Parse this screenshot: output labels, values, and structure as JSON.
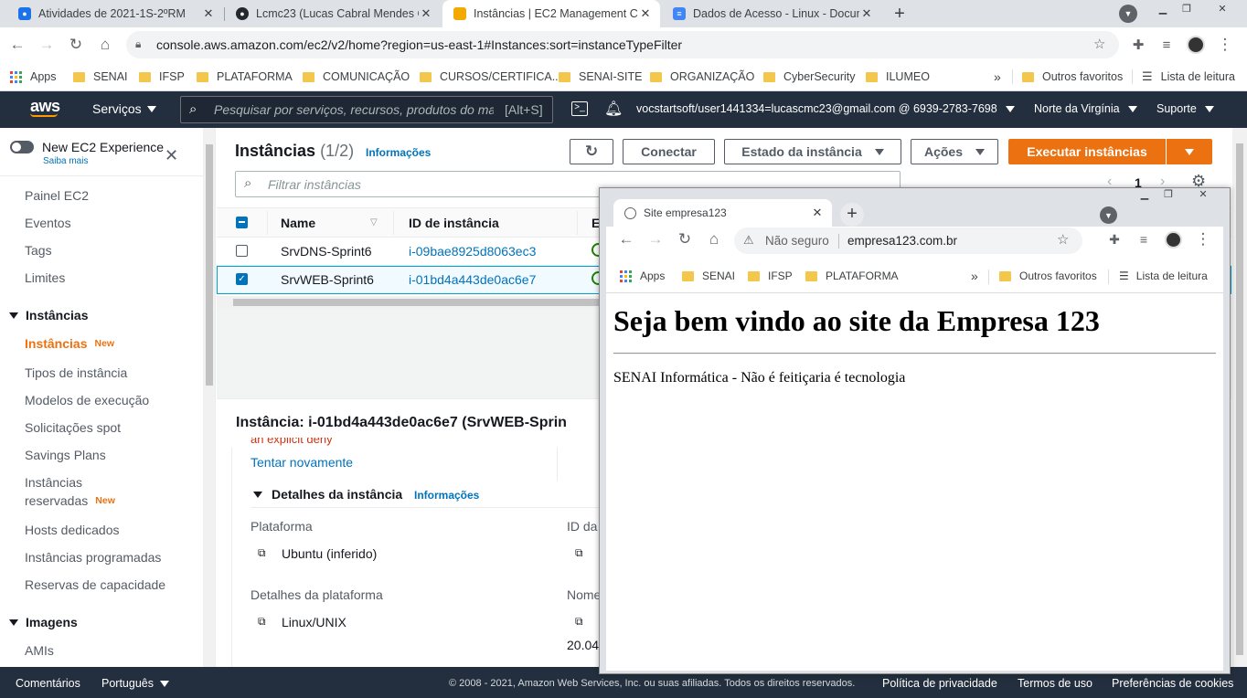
{
  "browser": {
    "tabs": [
      {
        "title": "Atividades de 2021-1S-2ºRM",
        "icon": "user-square-icon"
      },
      {
        "title": "Lcmc23 (Lucas Cabral Mendes Co",
        "icon": "github-icon"
      },
      {
        "title": "Instâncias | EC2 Management Co",
        "icon": "aws-box-icon"
      },
      {
        "title": "Dados de Acesso - Linux - Docum",
        "icon": "google-docs-icon"
      }
    ],
    "url": "console.aws.amazon.com/ec2/v2/home?region=us-east-1#Instances:sort=instanceTypeFilter",
    "bookmarks": [
      "Apps",
      "SENAI",
      "IFSP",
      "PLATAFORMA",
      "COMUNICAÇÃO",
      "CURSOS/CERTIFICA...",
      "SENAI-SITE",
      "ORGANIZAÇÃO",
      "CyberSecurity",
      "ILUMEO"
    ],
    "other_favorites": "Outros favoritos",
    "reading_list": "Lista de leitura",
    "more": "»"
  },
  "aws": {
    "logo": "aws",
    "services": "Serviços",
    "search_placeholder": "Pesquisar por serviços, recursos, produtos do mar",
    "search_shortcut": "[Alt+S]",
    "account": "vocstartsoft/user1441334=lucascmc23@gmail.com @ 6939-2783-7698",
    "region": "Norte da Virgínia",
    "support": "Suporte"
  },
  "sidebar": {
    "new_exp": "New EC2 Experience",
    "saiba": "Saiba mais",
    "items": [
      "Painel EC2",
      "Eventos",
      "Tags",
      "Limites"
    ],
    "section_instances": "Instâncias",
    "instances_items": [
      "Instâncias",
      "Tipos de instância",
      "Modelos de execução",
      "Solicitações spot",
      "Savings Plans",
      "Instâncias",
      "reservadas",
      "Hosts dedicados",
      "Instâncias programadas",
      "Reservas de capacidade"
    ],
    "new_badge": "New",
    "section_images": "Imagens",
    "ami": "AMIs"
  },
  "main": {
    "title": "Instâncias",
    "count": "(1/2)",
    "info": "Informações",
    "btn_connect": "Conectar",
    "btn_state": "Estado da instância",
    "btn_actions": "Ações",
    "btn_launch": "Executar instâncias",
    "filter_placeholder": "Filtrar instâncias",
    "page": "1",
    "columns": [
      "Name",
      "ID de instância",
      "E"
    ],
    "rows": [
      {
        "name": "SrvDNS-Sprint6",
        "id": "i-09bae8925d8063ec3",
        "checked": false
      },
      {
        "name": "SrvWEB-Sprint6",
        "id": "i-01bd4a443de0ac6e7",
        "checked": true
      }
    ],
    "detail_title": "Instância: i-01bd4a443de0ac6e7 (SrvWEB-Sprin",
    "explicit_deny": "an explicit deny",
    "retry": "Tentar novamente",
    "details_section": "Detalhes da instância",
    "platform_label": "Plataforma",
    "platform_value": "Ubuntu (inferido)",
    "platform_details_label": "Detalhes da plataforma",
    "platform_details_value": "Linux/UNIX",
    "id_label": "ID da",
    "name_label": "Nome",
    "version": "20.04"
  },
  "footer": {
    "comments": "Comentários",
    "language": "Português",
    "copyright": "© 2008 - 2021, Amazon Web Services, Inc. ou suas afiliadas. Todos os direitos reservados.",
    "privacy": "Política de privacidade",
    "terms": "Termos de uso",
    "cookies": "Preferências de cookies"
  },
  "popup": {
    "tab_title": "Site empresa123",
    "security": "Não seguro",
    "url": "empresa123.com.br",
    "bookmarks": [
      "Apps",
      "SENAI",
      "IFSP",
      "PLATAFORMA"
    ],
    "more": "»",
    "other_favorites": "Outros favoritos",
    "reading_list": "Lista de leitura",
    "heading": "Seja bem vindo ao site da Empresa 123",
    "paragraph": "SENAI Informática - Não é feitiçaria é tecnologia"
  },
  "colors": {
    "aws_dark": "#232f3e",
    "aws_orange": "#ec7211",
    "link": "#0073bb",
    "success": "#1d8102"
  }
}
